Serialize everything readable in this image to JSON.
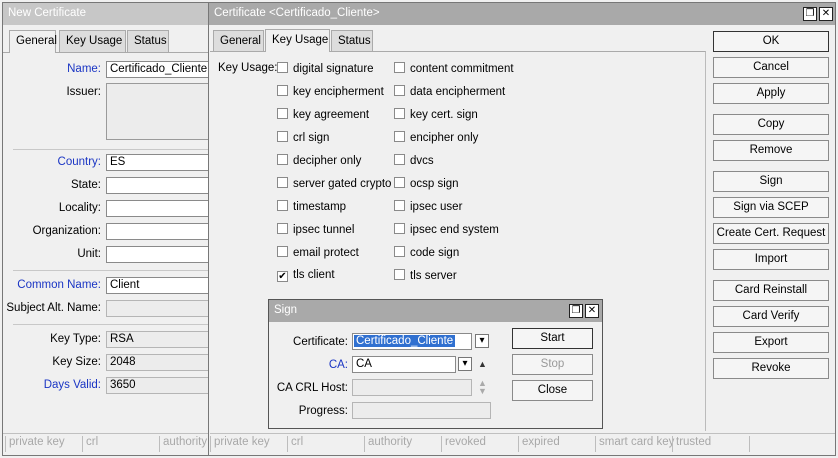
{
  "left_window": {
    "title": "New Certificate",
    "tabs": [
      "General",
      "Key Usage",
      "Status"
    ],
    "fields": {
      "name_label": "Name:",
      "name": "Certificado_Cliente",
      "issuer_label": "Issuer:",
      "country_label": "Country:",
      "country": "ES",
      "state_label": "State:",
      "locality_label": "Locality:",
      "organization_label": "Organization:",
      "unit_label": "Unit:",
      "common_name_label": "Common Name:",
      "common_name": "Client",
      "subject_alt_label": "Subject Alt. Name:",
      "key_type_label": "Key Type:",
      "key_type": "RSA",
      "key_size_label": "Key Size:",
      "key_size": "2048",
      "days_valid_label": "Days Valid:",
      "days_valid": "3650"
    },
    "status": [
      "private key",
      "crl",
      "authority"
    ]
  },
  "main_window": {
    "title": "Certificate <Certificado_Cliente>",
    "tabs": [
      "General",
      "Key Usage",
      "Status"
    ],
    "key_usage_label": "Key Usage:",
    "col1": [
      {
        "label": "digital signature",
        "checked": false
      },
      {
        "label": "key encipherment",
        "checked": false
      },
      {
        "label": "key agreement",
        "checked": false
      },
      {
        "label": "crl sign",
        "checked": false
      },
      {
        "label": "decipher only",
        "checked": false
      },
      {
        "label": "server gated crypto",
        "checked": false
      },
      {
        "label": "timestamp",
        "checked": false
      },
      {
        "label": "ipsec tunnel",
        "checked": false
      },
      {
        "label": "email protect",
        "checked": false
      },
      {
        "label": "tls client",
        "checked": true
      }
    ],
    "col2": [
      {
        "label": "content commitment",
        "checked": false
      },
      {
        "label": "data encipherment",
        "checked": false
      },
      {
        "label": "key cert. sign",
        "checked": false
      },
      {
        "label": "encipher only",
        "checked": false
      },
      {
        "label": "dvcs",
        "checked": false
      },
      {
        "label": "ocsp sign",
        "checked": false
      },
      {
        "label": "ipsec user",
        "checked": false
      },
      {
        "label": "ipsec end system",
        "checked": false
      },
      {
        "label": "code sign",
        "checked": false
      },
      {
        "label": "tls server",
        "checked": false
      }
    ],
    "buttons": [
      "OK",
      "Cancel",
      "Apply",
      "Copy",
      "Remove",
      "Sign",
      "Sign via SCEP",
      "Create Cert. Request",
      "Import",
      "Card Reinstall",
      "Card Verify",
      "Export",
      "Revoke"
    ],
    "status": [
      "private key",
      "crl",
      "authority",
      "revoked",
      "expired",
      "smart card key",
      "trusted"
    ]
  },
  "sign_dialog": {
    "title": "Sign",
    "certificate_label": "Certificate:",
    "certificate": "Certificado_Cliente",
    "ca_label": "CA:",
    "ca": "CA",
    "ca_crl_host_label": "CA CRL Host:",
    "ca_crl_host": "",
    "progress_label": "Progress:",
    "start": "Start",
    "stop": "Stop",
    "close": "Close"
  },
  "icons": {
    "restore": "restore-icon",
    "close": "close-icon",
    "dropdown": "dropdown-icon"
  }
}
